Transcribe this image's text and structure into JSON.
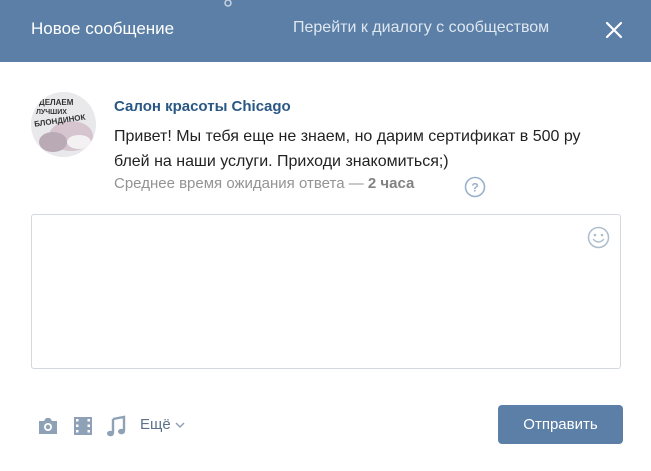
{
  "header": {
    "title": "Новое сообщение",
    "community_link": "Перейти к диалогу с сообществом",
    "close_icon": "close-icon"
  },
  "message": {
    "group_name": "Салон красоты Chicago",
    "avatar_text": "ДЕЛАЕМ ЛУЧШИХ БЛОНДИНОК",
    "greeting": "Привет! Мы тебя еще не знаем, но дарим сертификат в 500 рублей на наши услуги. Приходи знакомиться;)",
    "wait_prefix": "Среднее время ожидания ответа —",
    "wait_value": "2 часа",
    "help_icon": "question-icon"
  },
  "composer": {
    "text": "",
    "emoji_icon": "smile-icon"
  },
  "toolbar": {
    "photo_icon": "camera-icon",
    "video_icon": "film-icon",
    "audio_icon": "music-note-icon",
    "more_label": "Ещё",
    "send_label": "Отправить"
  },
  "colors": {
    "header_bg": "#5b7fa6",
    "link": "#2a5885",
    "button_bg": "#5b7fa6"
  }
}
